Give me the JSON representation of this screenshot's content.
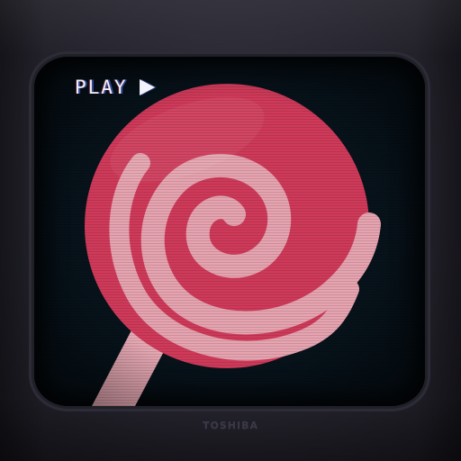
{
  "screen": {
    "osd_label": "PLAY",
    "osd_icon": "play-icon",
    "lollipop_color": "#d03a5a",
    "swirl_color": "#e6a4b0",
    "stick_color": "#e7a9b4"
  },
  "tv": {
    "brand": "TOSHIBA"
  }
}
